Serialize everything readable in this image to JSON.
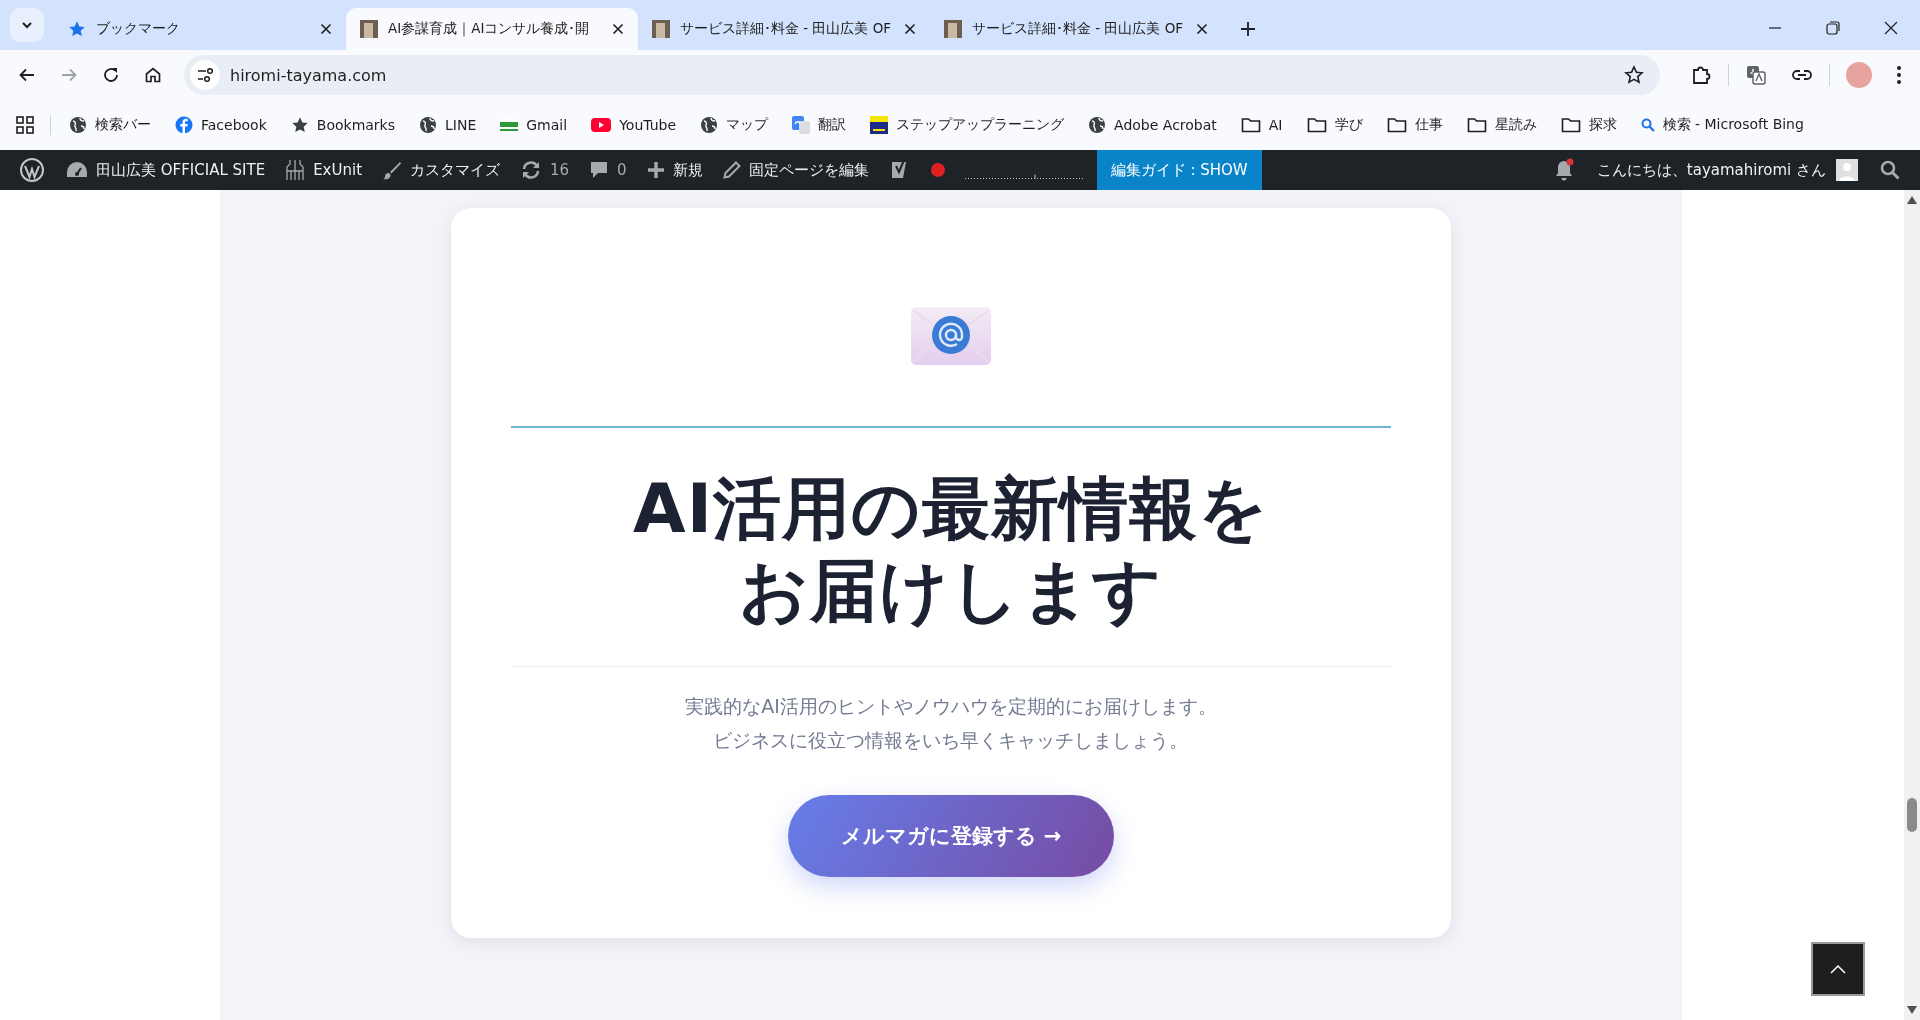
{
  "tabs": [
    {
      "title": "ブックマーク",
      "kind": "bookmarks",
      "selected": false
    },
    {
      "title": "AI参謀育成｜AIコンサル養成･開",
      "kind": "site",
      "selected": true
    },
    {
      "title": "サービス詳細･料金 - 田山広美 OF",
      "kind": "site",
      "selected": false
    },
    {
      "title": "サービス詳細･料金 - 田山広美 OF",
      "kind": "site",
      "selected": false
    }
  ],
  "address_bar": {
    "url": "hiromi-tayama.com"
  },
  "bookmarks": [
    {
      "label": "検索バー",
      "kind": "globe"
    },
    {
      "label": "Facebook",
      "kind": "facebook"
    },
    {
      "label": "Bookmarks",
      "kind": "star"
    },
    {
      "label": "LINE",
      "kind": "globe"
    },
    {
      "label": "Gmail",
      "kind": "itc"
    },
    {
      "label": "YouTube",
      "kind": "youtube"
    },
    {
      "label": "マップ",
      "kind": "globe"
    },
    {
      "label": "翻訳",
      "kind": "translate"
    },
    {
      "label": "ステップアップラーニング",
      "kind": "spi"
    },
    {
      "label": "Adobe Acrobat",
      "kind": "globe"
    },
    {
      "label": "AI",
      "kind": "folder"
    },
    {
      "label": "学び",
      "kind": "folder"
    },
    {
      "label": "仕事",
      "kind": "folder"
    },
    {
      "label": "星読み",
      "kind": "folder"
    },
    {
      "label": "探求",
      "kind": "folder"
    },
    {
      "label": "検索 - Microsoft Bing",
      "kind": "search"
    }
  ],
  "admin_bar": {
    "items": [
      {
        "label": "田山広美 OFFICIAL SITE",
        "kind": "dashboard"
      },
      {
        "label": "ExUnit",
        "kind": "exunit"
      },
      {
        "label": "カスタマイズ",
        "kind": "brush"
      },
      {
        "label": "16",
        "kind": "updates"
      },
      {
        "label": "0",
        "kind": "comments"
      },
      {
        "label": "新規",
        "kind": "plus"
      },
      {
        "label": "固定ページを編集",
        "kind": "pencil"
      }
    ],
    "guide_button": "編集ガイド : SHOW",
    "greeting": "こんにちは、tayamahiromi さん"
  },
  "newsletter": {
    "title_lines": [
      "AI活用の最新情報を",
      "お届けします"
    ],
    "description_lines": [
      "実践的なAI活用のヒントやノウハウを定期的にお届けします。",
      "ビジネスに役立つ情報をいち早くキャッチしましょう。"
    ],
    "button": "メルマガに登録する →"
  }
}
